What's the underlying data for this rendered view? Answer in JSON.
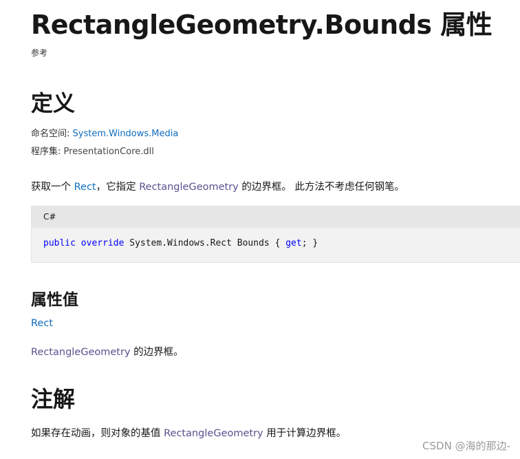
{
  "page": {
    "title": "RectangleGeometry.Bounds 属性",
    "reference_label": "参考"
  },
  "definition": {
    "heading": "定义",
    "namespace_label": "命名空间:",
    "namespace_value": "System.Windows.Media",
    "assembly_label": "程序集:",
    "assembly_value": "PresentationCore.dll"
  },
  "summary": {
    "prefix": "获取一个 ",
    "link1": "Rect",
    "middle": "，它指定 ",
    "link2": "RectangleGeometry",
    "suffix": " 的边界框。 此方法不考虑任何钢笔。"
  },
  "code": {
    "language": "C#",
    "kw_public": "public",
    "kw_override": "override",
    "type_and_name": " System.Windows.Rect Bounds { ",
    "kw_get": "get",
    "end": "; }"
  },
  "property_value": {
    "heading": "属性值",
    "type_link": "Rect",
    "desc_link": "RectangleGeometry",
    "desc_suffix": " 的边界框。"
  },
  "remarks": {
    "heading": "注解",
    "prefix": "如果存在动画，则对象的基值 ",
    "link": "RectangleGeometry",
    "suffix": " 用于计算边界框。"
  },
  "watermark": "CSDN @海的那边-",
  "colors": {
    "link_blue": "#0f6cbd",
    "link_purple": "#5c4f8f",
    "keyword": "#0000ff"
  }
}
